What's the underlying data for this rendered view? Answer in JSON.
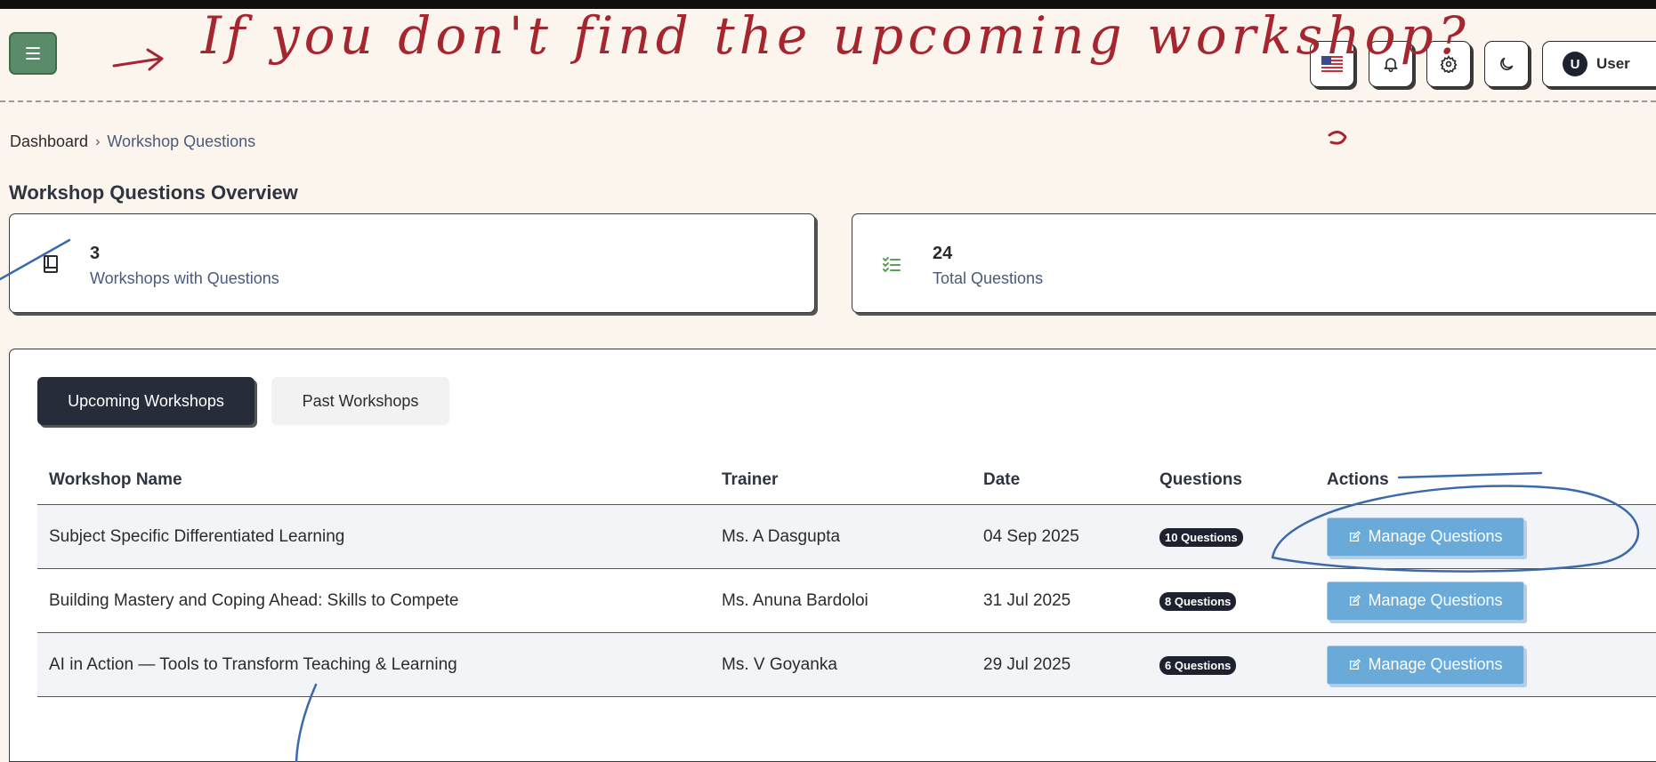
{
  "header": {
    "menu_icon": "hamburger-icon",
    "buttons": {
      "language_icon": "us-flag-icon",
      "notifications_icon": "bell-icon",
      "settings_icon": "gear-icon",
      "theme_icon": "moon-icon"
    },
    "user": {
      "avatar_initial": "U",
      "label": "User"
    }
  },
  "breadcrumb": {
    "home": "Dashboard",
    "separator": "›",
    "current": "Workshop Questions"
  },
  "page_title": "Workshop Questions Overview",
  "stats": [
    {
      "value": "3",
      "label": "Workshops with Questions",
      "icon": "book-icon"
    },
    {
      "value": "24",
      "label": "Total Questions",
      "icon": "checklist-icon"
    }
  ],
  "tabs": {
    "upcoming": "Upcoming Workshops",
    "past": "Past Workshops",
    "active": "upcoming"
  },
  "table": {
    "columns": {
      "name": "Workshop Name",
      "trainer": "Trainer",
      "date": "Date",
      "questions": "Questions",
      "actions": "Actions"
    },
    "rows": [
      {
        "name": "Subject Specific Differentiated Learning",
        "trainer": "Ms. A Dasgupta",
        "date": "04 Sep 2025",
        "questions": "10 Questions",
        "action": "Manage Questions"
      },
      {
        "name": "Building Mastery and Coping Ahead: Skills to Compete",
        "trainer": "Ms. Anuna Bardoloi",
        "date": "31 Jul 2025",
        "questions": "8 Questions",
        "action": "Manage Questions"
      },
      {
        "name": "AI in Action — Tools to Transform Teaching & Learning",
        "trainer": "Ms. V Goyanka",
        "date": "29 Jul 2025",
        "questions": "6 Questions",
        "action": "Manage Questions"
      }
    ]
  },
  "annotation": {
    "handwritten_note": "If you don't find the upcoming workshop?"
  },
  "colors": {
    "background": "#fcf5ee",
    "menu_button": "#5b8c6a",
    "active_tab": "#262c3a",
    "action_button": "#6aaad8",
    "red_ink": "#a5262f",
    "blue_ink": "#3a6aa8"
  }
}
